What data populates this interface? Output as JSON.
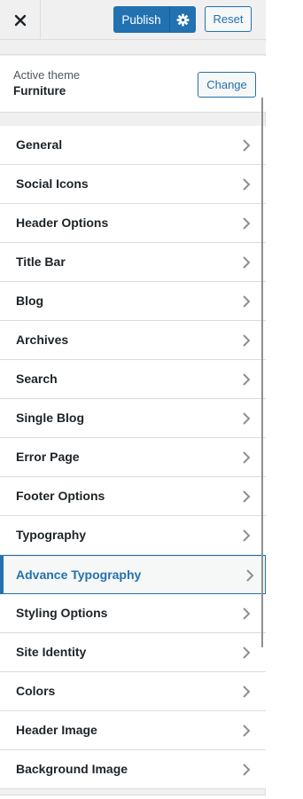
{
  "topbar": {
    "close_icon": "close-icon",
    "publish_label": "Publish",
    "settings_icon": "gear-icon",
    "reset_label": "Reset",
    "accent_color": "#2271b1"
  },
  "theme": {
    "label": "Active theme",
    "name": "Furniture",
    "change_label": "Change"
  },
  "menu": {
    "items": [
      {
        "label": "General"
      },
      {
        "label": "Social Icons"
      },
      {
        "label": "Header Options"
      },
      {
        "label": "Title Bar"
      },
      {
        "label": "Blog"
      },
      {
        "label": "Archives"
      },
      {
        "label": "Search"
      },
      {
        "label": "Single Blog"
      },
      {
        "label": "Error Page"
      },
      {
        "label": "Footer Options"
      },
      {
        "label": "Typography"
      },
      {
        "label": "Advance Typography",
        "active": true
      },
      {
        "label": "Styling Options"
      },
      {
        "label": "Site Identity"
      },
      {
        "label": "Colors"
      },
      {
        "label": "Header Image"
      },
      {
        "label": "Background Image"
      }
    ]
  }
}
